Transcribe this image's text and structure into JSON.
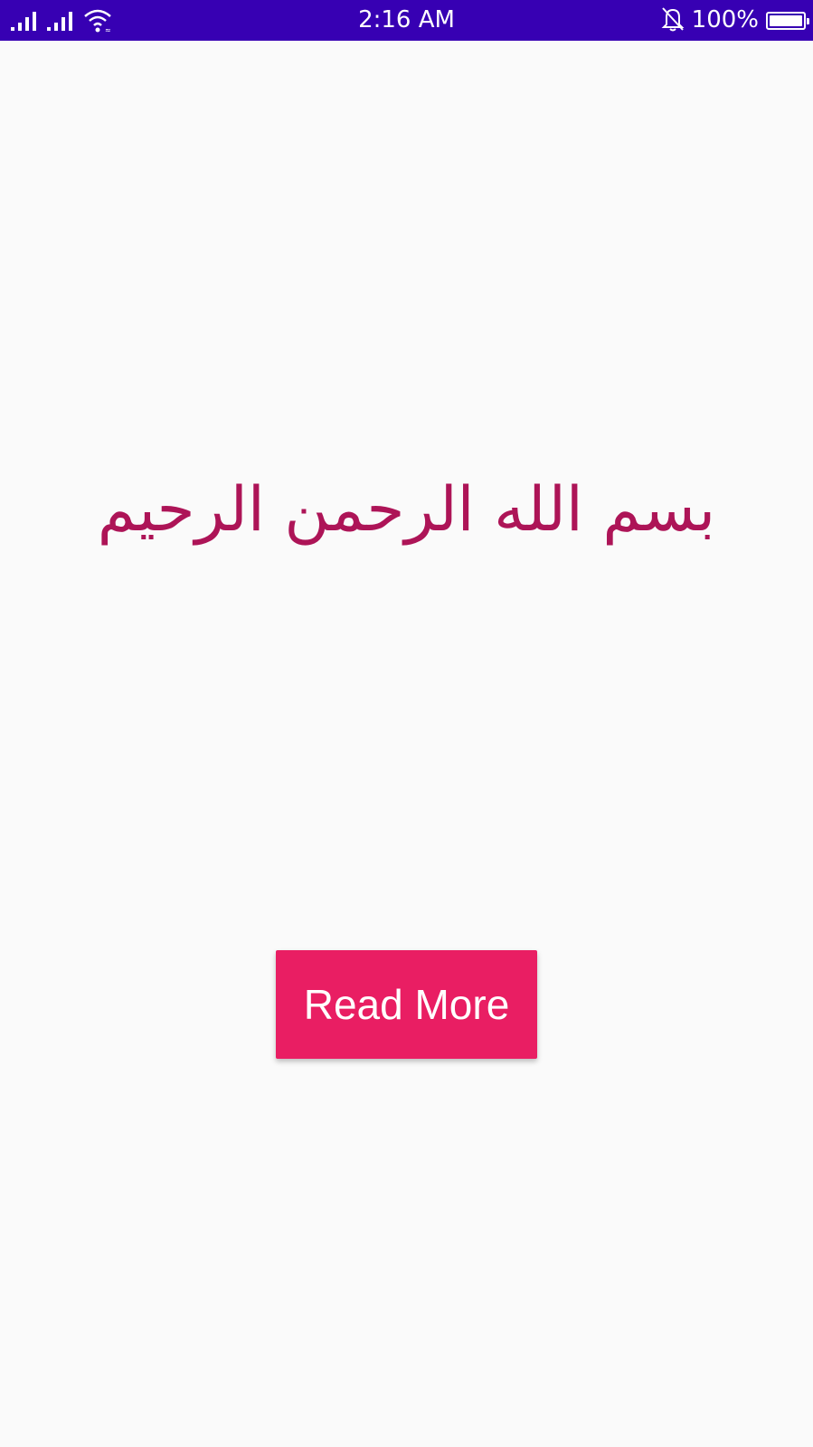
{
  "status_bar": {
    "time": "2:16 AM",
    "battery_percent_label": "100%",
    "battery_level": 1.0,
    "background_color": "#3700b3",
    "icons": [
      "signal-icon",
      "signal-icon",
      "wifi-icon",
      "bell-off-icon",
      "battery-icon"
    ]
  },
  "main": {
    "arabic_text": "بسم الله الرحمن الرحيم",
    "arabic_text_color": "#ad1457"
  },
  "button": {
    "label": "Read More",
    "color": "#e91e63"
  }
}
